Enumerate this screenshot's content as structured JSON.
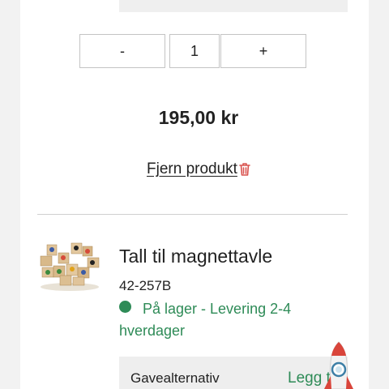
{
  "quantity": {
    "minus_label": "-",
    "value": "1",
    "plus_label": "+"
  },
  "price": "195,00 kr",
  "remove_label": "Fjern produkt",
  "product": {
    "name": "Tall til magnettavle",
    "sku": "42-257B",
    "stock_status": "På lager - Levering 2-4 hverdager"
  },
  "gift": {
    "label": "Gavealternativ",
    "add_label": "Legg til"
  },
  "colors": {
    "accent_green": "#2e8b57",
    "trash_red": "#d9534f"
  },
  "icons": [
    "trash-icon",
    "stock-indicator-dot",
    "rocket-icon"
  ]
}
